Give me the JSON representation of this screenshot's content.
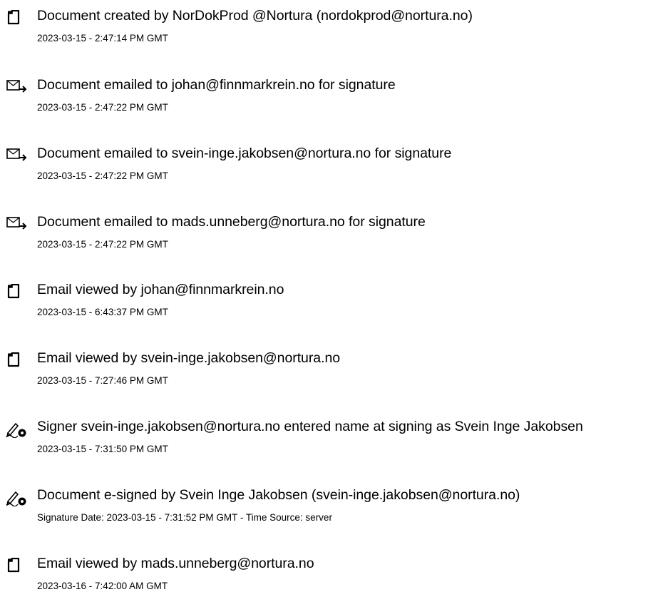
{
  "events": [
    {
      "icon": "document-icon",
      "title": "Document created by NorDokProd @Nortura (nordokprod@nortura.no)",
      "timestamp": "2023-03-15 - 2:47:14 PM GMT"
    },
    {
      "icon": "email-sent-icon",
      "title": "Document emailed to johan@finnmarkrein.no for signature",
      "timestamp": "2023-03-15 - 2:47:22 PM GMT"
    },
    {
      "icon": "email-sent-icon",
      "title": "Document emailed to svein-inge.jakobsen@nortura.no for signature",
      "timestamp": "2023-03-15 - 2:47:22 PM GMT"
    },
    {
      "icon": "email-sent-icon",
      "title": "Document emailed to mads.unneberg@nortura.no for signature",
      "timestamp": "2023-03-15 - 2:47:22 PM GMT"
    },
    {
      "icon": "document-icon",
      "title": "Email viewed by johan@finnmarkrein.no",
      "timestamp": "2023-03-15 - 6:43:37 PM GMT"
    },
    {
      "icon": "document-icon",
      "title": "Email viewed by svein-inge.jakobsen@nortura.no",
      "timestamp": "2023-03-15 - 7:27:46 PM GMT"
    },
    {
      "icon": "pen-signature-icon",
      "title": "Signer svein-inge.jakobsen@nortura.no entered name at signing as Svein Inge Jakobsen",
      "timestamp": "2023-03-15 - 7:31:50 PM GMT"
    },
    {
      "icon": "pen-signature-icon",
      "title": "Document e-signed by Svein Inge Jakobsen (svein-inge.jakobsen@nortura.no)",
      "timestamp": "Signature Date: 2023-03-15 - 7:31:52 PM GMT - Time Source: server"
    },
    {
      "icon": "document-icon",
      "title": "Email viewed by mads.unneberg@nortura.no",
      "timestamp": "2023-03-16 - 7:42:00 AM GMT"
    }
  ]
}
